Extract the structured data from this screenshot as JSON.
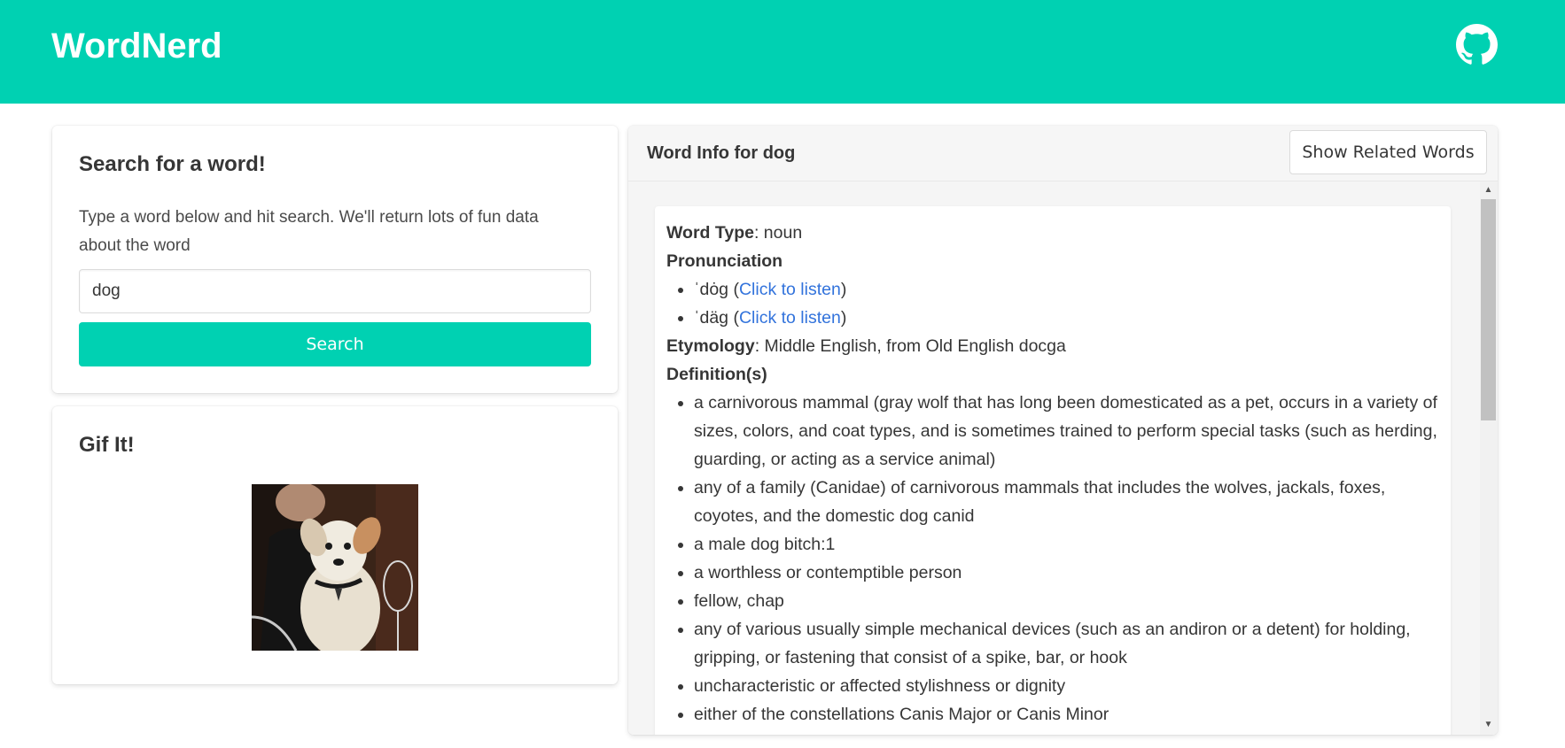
{
  "header": {
    "brand": "WordNerd",
    "color": "#00d1b2",
    "github_icon": "github-icon"
  },
  "search": {
    "title": "Search for a word!",
    "description": "Type a word below and hit search. We'll return lots of fun data about the word",
    "input_value": "dog",
    "button_label": "Search"
  },
  "gif": {
    "title": "Gif It!",
    "image": "dog-gif-image"
  },
  "word_info": {
    "title": "Word Info for dog",
    "related_button": "Show Related Words",
    "type_label": "Word Type",
    "type_value": ": noun",
    "pronunciation_label": "Pronunciation",
    "pronunciations": [
      {
        "text": "ˈdȯg (",
        "link": "Click to listen",
        "close": ")"
      },
      {
        "text": "ˈdäg (",
        "link": "Click to listen",
        "close": ")"
      }
    ],
    "etymology_label": "Etymology",
    "etymology_value": ": Middle English, from Old English docga",
    "definitions_label": "Definition(s)",
    "definitions": [
      "a carnivorous mammal (gray wolf that has long been domesticated as a pet, occurs in a variety of sizes, colors, and coat types, and is sometimes trained to perform special tasks (such as herding, guarding, or acting as a service animal)",
      "any of a family (Canidae) of carnivorous mammals that includes the wolves, jackals, foxes, coyotes, and the domestic dog canid",
      "a male dog bitch:1",
      "a worthless or contemptible person",
      "fellow, chap",
      "any of various usually simple mechanical devices (such as an andiron or a detent) for holding, gripping, or fastening that consist of a spike, bar, or hook",
      "uncharacteristic or affected stylishness or dignity",
      "either of the constellations Canis Major or Canis Minor"
    ]
  }
}
